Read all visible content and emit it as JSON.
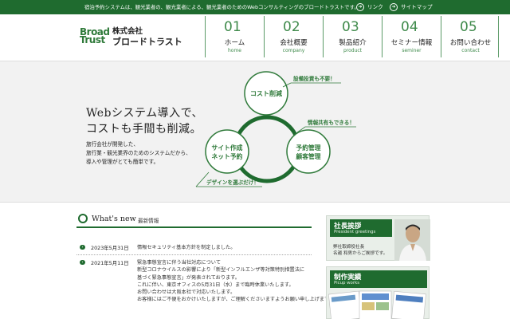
{
  "topbar": {
    "tagline": "宿泊予約システムは、観光業者の、観光業者による、観光業者のためのWebコンサルティングのブロードトラストです。",
    "link_label": "リンク",
    "sitemap_label": "サイトマップ"
  },
  "logo": {
    "line1": "Broad",
    "line2": "Trust"
  },
  "company": {
    "line1": "株式会社",
    "line2": "ブロードトラスト"
  },
  "nav": [
    {
      "num": "01",
      "jp": "ホーム",
      "en": "home"
    },
    {
      "num": "02",
      "jp": "会社概要",
      "en": "company"
    },
    {
      "num": "03",
      "jp": "製品紹介",
      "en": "product"
    },
    {
      "num": "04",
      "jp": "セミナー情報",
      "en": "seminer"
    },
    {
      "num": "05",
      "jp": "お問い合わせ",
      "en": "contact"
    }
  ],
  "hero": {
    "headline1": "Webシステム導入で、",
    "headline2": "コストも手間も削減。",
    "desc1": "旅行会社が開発した、",
    "desc2": "旅行業・観光業界のためのシステムだから、",
    "desc3": "導入や管理がとても簡単です。",
    "circle_top": "コスト削減",
    "circle_left1": "サイト作成",
    "circle_left2": "ネット予約",
    "circle_right1": "予約管理",
    "circle_right2": "顧客管理",
    "tag1": "設備投資も不要！",
    "tag2": "情報共有もできる！",
    "tag3": "デザインを選ぶだけ！"
  },
  "news": {
    "title": "What's new",
    "subtitle": "最新情報",
    "items": [
      {
        "date": "2023年5月31日",
        "lines": [
          "情報セキュリティ基本方針を制定しました。"
        ]
      },
      {
        "date": "2021年5月11日",
        "lines": [
          "緊急事態宣言に伴う当社対応について",
          "新型コロナウイルスの影響により「新型インフルエンザ等対策特別措置法に",
          "基づく緊急事態宣言」が発表されております。",
          "これに伴い、東京オフィスの5月31日（水）まで臨時休業いたします。",
          "お問い合わせは大阪本社で対応いたします。",
          "お客様にはご不便をおかけいたしますが、ご理解くださいますようお願い申し上げます。"
        ]
      }
    ]
  },
  "sidebar": {
    "greet_title": "社長挨拶",
    "greet_en": "President greetings",
    "greet_role": "弊社取締役社長",
    "greet_name": "名越 和男からご挨拶です。",
    "works_title": "制作実績",
    "works_en": "Picup works"
  },
  "colors": {
    "brand_green": "#1f6b2f",
    "accent_green": "#3f8a4b"
  }
}
